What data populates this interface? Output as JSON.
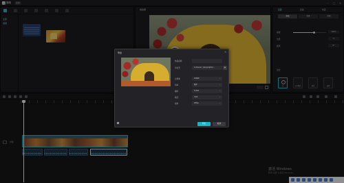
{
  "app": {
    "name": "剪映",
    "menu_label": "菜单"
  },
  "media": {
    "sidebar": [
      "全部",
      "视频"
    ],
    "items": [
      {
        "label": ""
      },
      {
        "label": ""
      }
    ]
  },
  "player": {
    "title": "播放器"
  },
  "props": {
    "tabs": [
      "画面",
      "变速",
      "动画"
    ],
    "sub_tabs": [
      "基础",
      "抠像",
      "蒙版"
    ],
    "rows": [
      {
        "label": "缩放",
        "value": "100%"
      },
      {
        "label": "位置",
        "value": "0"
      },
      {
        "label": "旋转",
        "value": "0°"
      }
    ],
    "blend_label": "混合",
    "blend_modes": [
      "无",
      "正片叠底",
      "滤色",
      "变暗"
    ]
  },
  "timeline": {
    "track_label": "封面"
  },
  "dialog": {
    "title": "导出",
    "thumb_caption": "",
    "fields": [
      {
        "label": "作品名称",
        "value": ""
      },
      {
        "label": "导出至",
        "value": "C:/Users/.../JianyingPro/...",
        "has_button": true
      },
      {
        "label": "分辨率",
        "value": "1080P",
        "dropdown": true
      },
      {
        "label": "码率",
        "value": "推荐",
        "dropdown": true
      },
      {
        "label": "编码",
        "value": "H.264",
        "dropdown": true
      },
      {
        "label": "格式",
        "value": "mp4",
        "dropdown": true
      },
      {
        "label": "帧率",
        "value": "30fps",
        "dropdown": true
      }
    ],
    "size_info": "",
    "footer_info": "",
    "export_label": "导出",
    "cancel_label": "取消"
  },
  "activate": {
    "title": "激活 Windows",
    "subtitle": "转到\"设置\"以激活 Windows。"
  }
}
